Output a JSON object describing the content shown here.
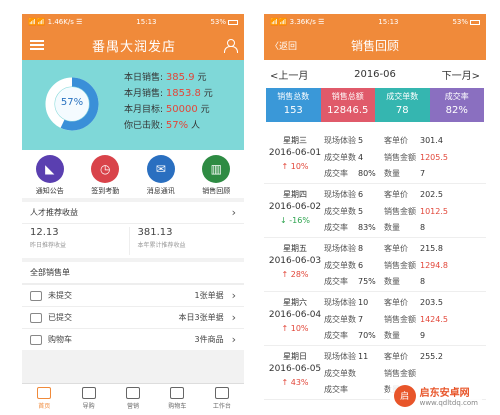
{
  "left": {
    "status": {
      "left": "📶📶 1.46K/s ☰",
      "time": "15:13",
      "battery": "53%"
    },
    "header": {
      "title": "番禺大润发店"
    },
    "stats": {
      "donut_percent_label": "57%",
      "donut_fraction": 0.57,
      "rows": [
        {
          "label": "本日销售:",
          "value": "385.9",
          "unit": "元"
        },
        {
          "label": "本月销售:",
          "value": "1853.8",
          "unit": "元"
        },
        {
          "label": "本月目标:",
          "value": "50000",
          "unit": "元"
        },
        {
          "label": "你已击败:",
          "value": "57%",
          "unit": "人"
        }
      ]
    },
    "quick": [
      {
        "label": "通知公告",
        "color": "#5a3fb0"
      },
      {
        "label": "签到考勤",
        "color": "#d9434a"
      },
      {
        "label": "消息通讯",
        "color": "#2a6fc0"
      },
      {
        "label": "销售回顾",
        "color": "#2e8b43"
      }
    ],
    "talent": {
      "title": "人才推荐收益",
      "today_value": "12.13",
      "today_label": "昨日推荐收益",
      "year_value": "381.13",
      "year_label": "本年累计推荐收益"
    },
    "sales": {
      "title": "全部销售单",
      "rows": [
        {
          "name": "未提交",
          "count": "1张单据"
        },
        {
          "name": "已提交",
          "count": "本日3张单据"
        },
        {
          "name": "购物车",
          "count": "3件商品"
        }
      ]
    },
    "tabs": [
      "首页",
      "导购",
      "营销",
      "购物车",
      "工作台"
    ]
  },
  "right": {
    "status": {
      "left": "📶📶 3.36K/s ☰",
      "time": "15:13",
      "battery": "53%"
    },
    "header": {
      "back": "〈返回",
      "title": "销售回顾"
    },
    "month_nav": {
      "prev": "<上一月",
      "current": "2016-06",
      "next": "下一月>"
    },
    "kpis": [
      {
        "label": "销售总数",
        "value": "153",
        "color": "#3a98d8"
      },
      {
        "label": "销售总额",
        "value": "12846.5",
        "color": "#e05a6a"
      },
      {
        "label": "成交单数",
        "value": "78",
        "color": "#35b6b0"
      },
      {
        "label": "成交率",
        "value": "82%",
        "color": "#8a6fc0"
      }
    ],
    "labels": {
      "visitors": "现场体验",
      "deals": "成交单数",
      "rate": "成交率",
      "avg": "客单价",
      "amount": "销售金额",
      "qty": "数量"
    },
    "days": [
      {
        "week": "星期三",
        "date": "2016-06-01",
        "change": "↑ 10%",
        "dir": "up",
        "visitors": "5",
        "deals": "4",
        "rate": "80%",
        "avg": "301.4",
        "amount": "1205.5",
        "qty": "7"
      },
      {
        "week": "星期四",
        "date": "2016-06-02",
        "change": "↓ -16%",
        "dir": "down",
        "visitors": "6",
        "deals": "5",
        "rate": "83%",
        "avg": "202.5",
        "amount": "1012.5",
        "qty": "8"
      },
      {
        "week": "星期五",
        "date": "2016-06-03",
        "change": "↑ 28%",
        "dir": "up",
        "visitors": "8",
        "deals": "6",
        "rate": "75%",
        "avg": "215.8",
        "amount": "1294.8",
        "qty": "8"
      },
      {
        "week": "星期六",
        "date": "2016-06-04",
        "change": "↑ 10%",
        "dir": "up",
        "visitors": "10",
        "deals": "7",
        "rate": "70%",
        "avg": "203.5",
        "amount": "1424.5",
        "qty": "9"
      },
      {
        "week": "星期日",
        "date": "2016-06-05",
        "change": "↑ 43%",
        "dir": "up",
        "visitors": "11",
        "deals": "",
        "rate": "",
        "avg": "255.2",
        "amount": "",
        "qty": ""
      }
    ],
    "watermark": {
      "logo_char": "启",
      "name": "启东安卓网",
      "url": "www.qdltdq.com"
    }
  }
}
